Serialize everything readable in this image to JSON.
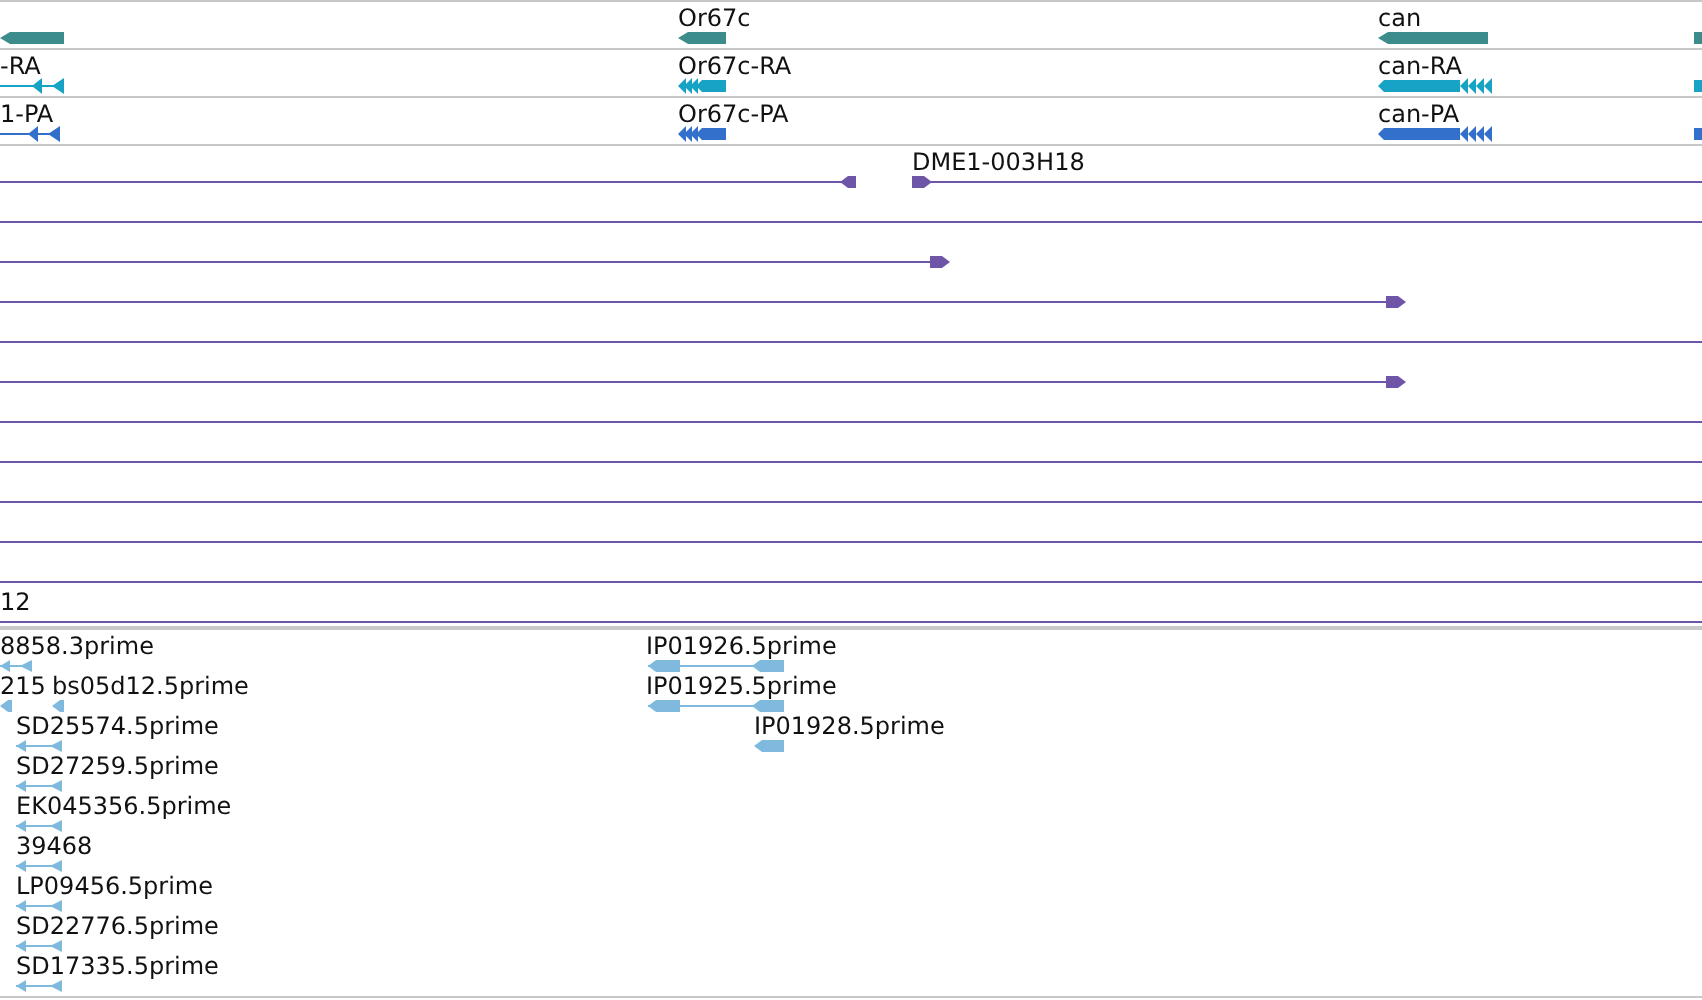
{
  "gene_track": {
    "rows": [
      {
        "color": "#3d8c8c",
        "features": [
          {
            "kind": "bar"
          },
          {
            "kind": "bar",
            "label": "Or67c"
          },
          {
            "kind": "bar",
            "label": "can"
          },
          {
            "kind": "stub"
          }
        ]
      },
      {
        "color": "#17a3c3",
        "features": [
          {
            "kind": "split",
            "label": "-RA"
          },
          {
            "kind": "chevrons",
            "label": "Or67c-RA"
          },
          {
            "kind": "chevrons",
            "label": "can-RA"
          },
          {
            "kind": "stub"
          }
        ]
      },
      {
        "color": "#3370cc",
        "features": [
          {
            "kind": "split",
            "label": "1-PA"
          },
          {
            "kind": "chevrons",
            "label": "Or67c-PA"
          },
          {
            "kind": "chevrons",
            "label": "can-PA"
          },
          {
            "kind": "stub"
          }
        ]
      }
    ]
  },
  "clone_track": {
    "rows": [
      {
        "features": [
          {
            "kind": "end-cap"
          },
          {
            "kind": "start-arrow",
            "label": "DME1-003H18"
          }
        ]
      },
      {
        "features": [
          {
            "kind": "line"
          }
        ]
      },
      {
        "features": [
          {
            "kind": "end-arrow"
          }
        ]
      },
      {
        "features": [
          {
            "kind": "end-arrow"
          }
        ]
      },
      {
        "features": [
          {
            "kind": "line"
          }
        ]
      },
      {
        "features": [
          {
            "kind": "end-arrow"
          }
        ]
      },
      {
        "features": [
          {
            "kind": "line"
          }
        ]
      },
      {
        "features": [
          {
            "kind": "line"
          }
        ]
      },
      {
        "features": [
          {
            "kind": "line"
          }
        ]
      },
      {
        "features": [
          {
            "kind": "line"
          }
        ]
      },
      {
        "features": [
          {
            "kind": "line"
          }
        ]
      },
      {
        "features": [
          {
            "kind": "line",
            "label": "12"
          }
        ]
      }
    ]
  },
  "est_track": {
    "rows": [
      {
        "features": [
          {
            "kind": "pair",
            "label": "8858.3prime"
          },
          {
            "kind": "pair",
            "label": "IP01926.5prime"
          }
        ]
      },
      {
        "features": [
          {
            "kind": "single",
            "label": "215"
          },
          {
            "kind": "single",
            "label": "bs05d12.5prime"
          },
          {
            "kind": "pair",
            "label": "IP01925.5prime"
          }
        ]
      },
      {
        "features": [
          {
            "kind": "pair",
            "label": "SD25574.5prime"
          },
          {
            "kind": "single",
            "label": "IP01928.5prime"
          }
        ]
      },
      {
        "features": [
          {
            "kind": "pair",
            "label": "SD27259.5prime"
          }
        ]
      },
      {
        "features": [
          {
            "kind": "pair",
            "label": "EK045356.5prime"
          }
        ]
      },
      {
        "features": [
          {
            "kind": "pair",
            "label": "39468"
          }
        ]
      },
      {
        "features": [
          {
            "kind": "pair",
            "label": "LP09456.5prime"
          }
        ]
      },
      {
        "features": [
          {
            "kind": "pair",
            "label": "SD22776.5prime"
          }
        ]
      },
      {
        "features": [
          {
            "kind": "pair",
            "label": "SD17335.5prime"
          }
        ]
      }
    ]
  }
}
